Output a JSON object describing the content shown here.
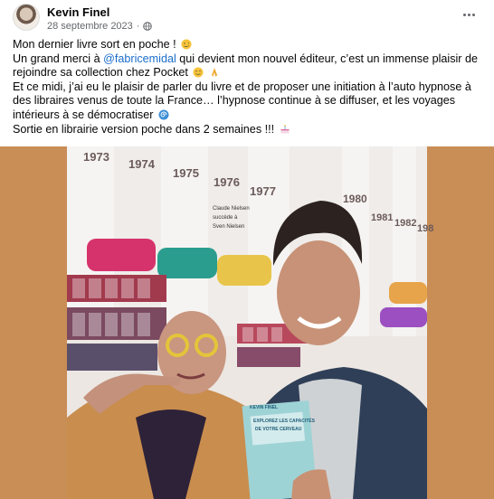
{
  "post": {
    "author": "Kevin Finel",
    "date": "28 septembre 2023",
    "date_separator": "·",
    "privacy_icon": "globe-icon",
    "more_icon": "more-options-icon",
    "lines": {
      "l1": "Mon dernier livre sort en poche !",
      "l2_before": "Un grand merci à ",
      "l2_mention": "@fabricemidal",
      "l2_after": " qui devient mon nouvel éditeur, c’est un immense plaisir de rejoindre sa collection chez Pocket",
      "l3": "Et ce midi, j’ai eu le plaisir de parler du livre et de proposer une initiation à l’auto hypnose à des libraires venus de toute la France…  l’hypnose continue à se diffuser, et les voyages intérieurs à se démocratiser",
      "l4": "Sortie en librairie version poche dans 2 semaines !!!"
    },
    "emojis": [
      "face-emoji",
      "smile-emoji",
      "pray-emoji",
      "spiral-emoji",
      "cake-emoji"
    ]
  },
  "photo": {
    "years": [
      "1973",
      "1974",
      "1975",
      "1976",
      "1977",
      "1980",
      "1981",
      "1982",
      "198"
    ],
    "poster_caption_1": "Claude Nielsen",
    "poster_caption_2": "succède à",
    "poster_caption_3": "Sven Nielsen",
    "book_title_1": "EXPLOREZ LES CAPACITÉS",
    "book_title_2": "DE VOTRE CERVEAU",
    "book_author": "KEVIN FINEL",
    "colors": {
      "wall": "#c98d56",
      "timeline": "#f2f0ee",
      "pink": "#d6336c",
      "teal": "#2a9d8f",
      "yellow": "#e8c54a"
    }
  }
}
